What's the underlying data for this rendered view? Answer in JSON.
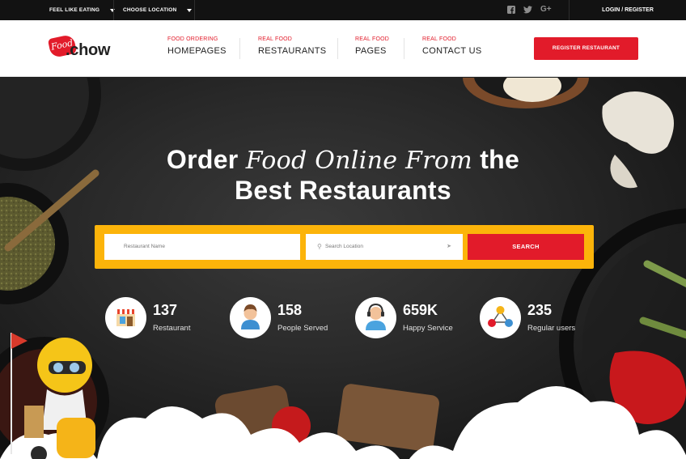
{
  "topbar": {
    "dropdown_eating": "FEEL LIKE EATING",
    "dropdown_location": "CHOOSE LOCATION",
    "login_register": "LOGIN / REGISTER"
  },
  "header": {
    "logo_badge": "Food",
    "logo_word": ".chow",
    "nav": [
      {
        "small": "FOOD ORDERING",
        "big": "HOMEPAGES"
      },
      {
        "small": "REAL FOOD",
        "big": "RESTAURANTS"
      },
      {
        "small": "REAL FOOD",
        "big": "PAGES"
      },
      {
        "small": "REAL FOOD",
        "big": "CONTACT US"
      }
    ],
    "register_button": "REGISTER RESTAURANT"
  },
  "hero": {
    "title_order": "Order",
    "title_script": "Food Online From",
    "title_the": "the",
    "title_line2": "Best Restaurants"
  },
  "search": {
    "name_placeholder": "Restaurant Name",
    "location_placeholder": "Search Location",
    "button_label": "SEARCH"
  },
  "stats": [
    {
      "value": "137",
      "label": "Restaurant",
      "icon": "restaurant-icon"
    },
    {
      "value": "158",
      "label": "People Served",
      "icon": "person-icon"
    },
    {
      "value": "659K",
      "label": "Happy Service",
      "icon": "support-agent-icon"
    },
    {
      "value": "235",
      "label": "Regular users",
      "icon": "network-users-icon"
    }
  ],
  "colors": {
    "brand_red": "#e21b2a",
    "search_yellow": "#fcb40a",
    "topbar_dark": "#121212"
  }
}
